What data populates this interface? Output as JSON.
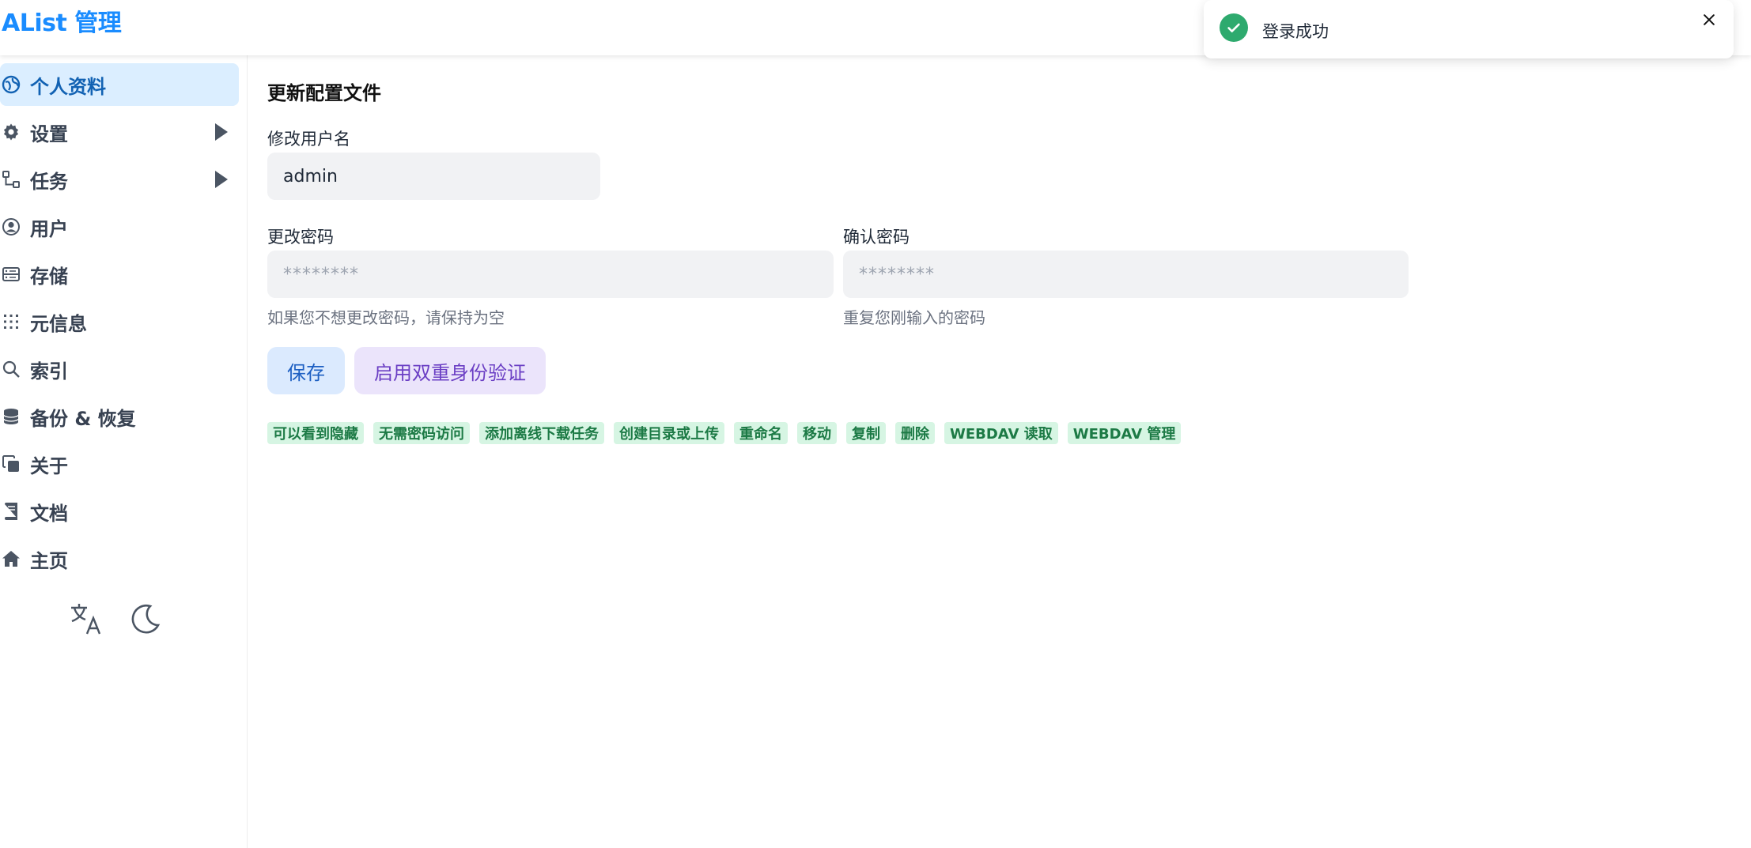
{
  "app": {
    "title": "AList 管理"
  },
  "sidebar": {
    "items": [
      {
        "label": "个人资料",
        "icon": "profile-icon"
      },
      {
        "label": "设置",
        "icon": "gear-icon"
      },
      {
        "label": "任务",
        "icon": "tasks-icon"
      },
      {
        "label": "用户",
        "icon": "user-icon"
      },
      {
        "label": "存储",
        "icon": "storage-icon"
      },
      {
        "label": "元信息",
        "icon": "meta-icon"
      },
      {
        "label": "索引",
        "icon": "search-icon"
      },
      {
        "label": "备份 & 恢复",
        "icon": "database-icon"
      },
      {
        "label": "关于",
        "icon": "about-icon"
      },
      {
        "label": "文档",
        "icon": "book-icon"
      },
      {
        "label": "主页",
        "icon": "home-icon"
      }
    ],
    "bottom_icons": [
      "translate-icon",
      "moon-icon"
    ]
  },
  "main": {
    "title": "更新配置文件",
    "username_label": "修改用户名",
    "username_value": "admin",
    "password_label": "更改密码",
    "password_placeholder": "********",
    "password_help": "如果您不想更改密码，请保持为空",
    "confirm_label": "确认密码",
    "confirm_placeholder": "********",
    "confirm_help": "重复您刚输入的密码",
    "save_label": "保存",
    "twofa_label": "启用双重身份验证",
    "permissions": [
      "可以看到隐藏",
      "无需密码访问",
      "添加离线下载任务",
      "创建目录或上传",
      "重命名",
      "移动",
      "复制",
      "删除",
      "WEBDAV 读取",
      "WEBDAV 管理"
    ]
  },
  "toast": {
    "message": "登录成功",
    "icon": "check-circle-icon"
  },
  "colors": {
    "brand": "#1a8cff",
    "active_bg": "#dbeeff",
    "success": "#2eaa6e",
    "perm_bg": "#d6f5e3"
  }
}
